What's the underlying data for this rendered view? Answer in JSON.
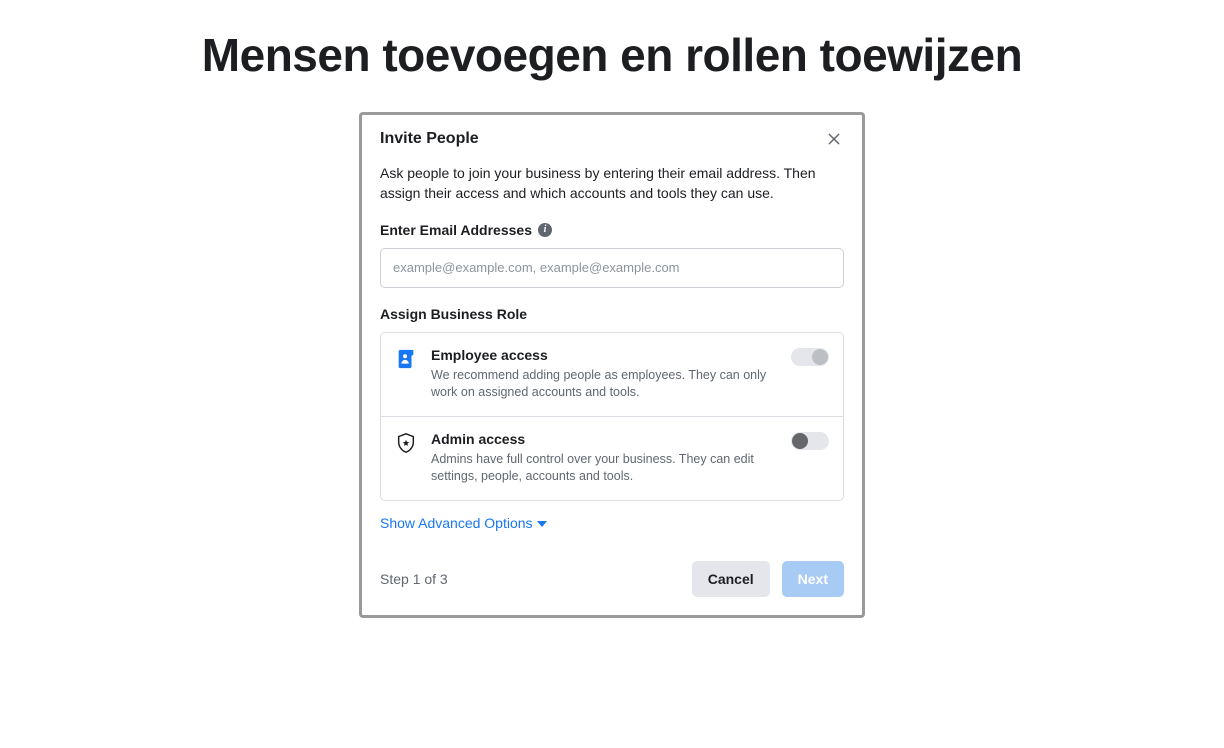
{
  "page": {
    "title": "Mensen toevoegen en rollen toewijzen"
  },
  "modal": {
    "title": "Invite People",
    "description": "Ask people to join your business by entering their email address. Then assign their access and which accounts and tools they can use.",
    "email_label": "Enter Email Addresses",
    "email_placeholder": "example@example.com, example@example.com",
    "assign_role_label": "Assign Business Role",
    "roles": {
      "employee": {
        "title": "Employee access",
        "desc": "We recommend adding people as employees. They can only work on assigned accounts and tools."
      },
      "admin": {
        "title": "Admin access",
        "desc": "Admins have full control over your business. They can edit settings, people, accounts and tools."
      }
    },
    "advanced_link": "Show Advanced Options",
    "step_label": "Step 1 of 3",
    "cancel_label": "Cancel",
    "next_label": "Next"
  }
}
